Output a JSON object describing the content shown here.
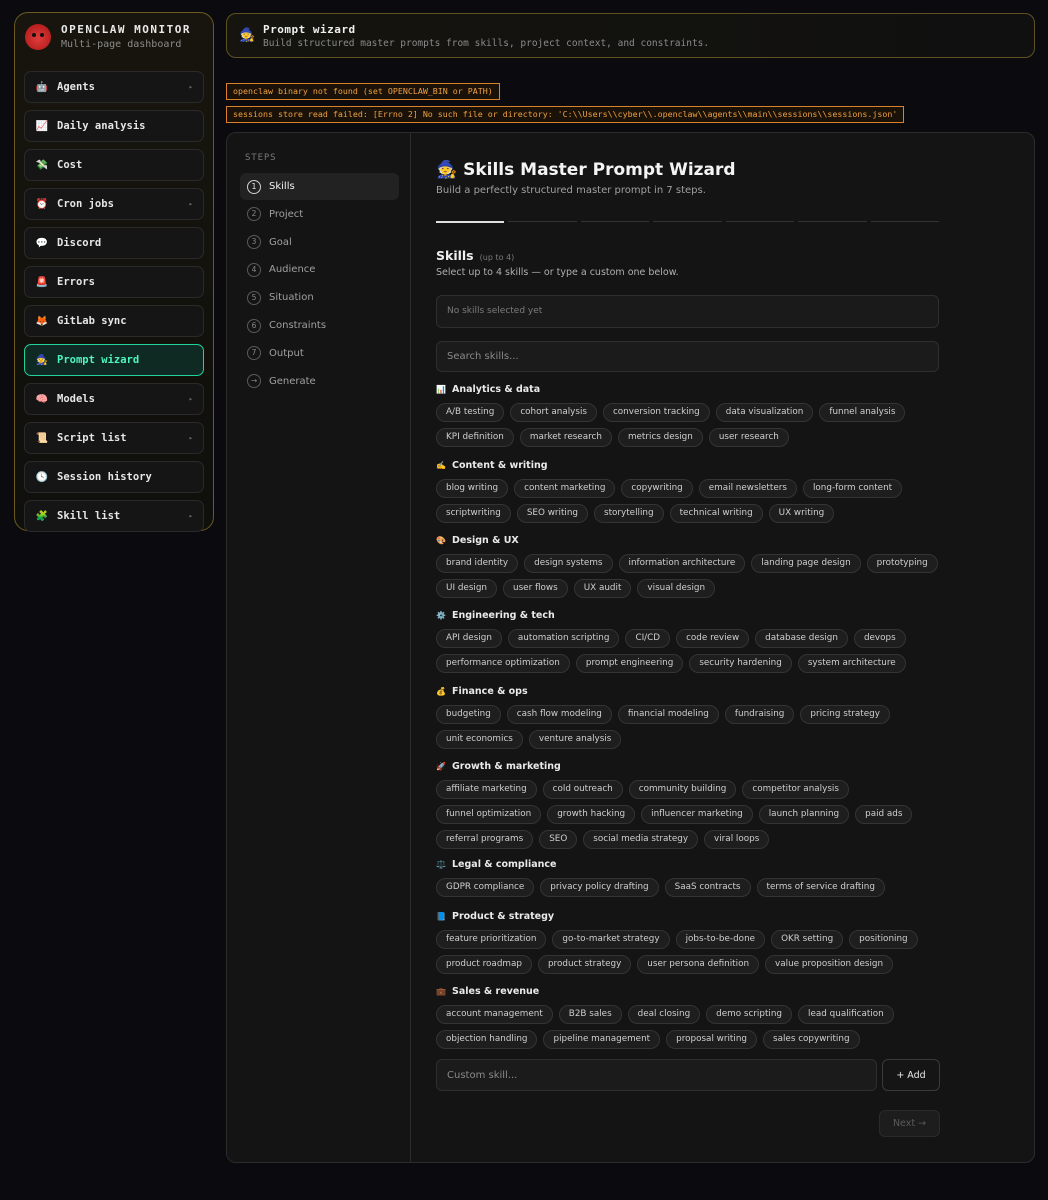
{
  "brand": {
    "title": "OPENCLAW MONITOR",
    "subtitle": "Multi-page dashboard"
  },
  "nav": [
    {
      "label": "Agents",
      "icon": "🤖",
      "chevron": true
    },
    {
      "label": "Daily analysis",
      "icon": "📈",
      "chevron": false
    },
    {
      "label": "Cost",
      "icon": "💸",
      "chevron": false
    },
    {
      "label": "Cron jobs",
      "icon": "⏰",
      "chevron": true
    },
    {
      "label": "Discord",
      "icon": "💬",
      "chevron": false
    },
    {
      "label": "Errors",
      "icon": "🚨",
      "chevron": false
    },
    {
      "label": "GitLab sync",
      "icon": "🦊",
      "chevron": false
    },
    {
      "label": "Prompt wizard",
      "icon": "🧙",
      "chevron": false,
      "active": true
    },
    {
      "label": "Models",
      "icon": "🧠",
      "chevron": true
    },
    {
      "label": "Script list",
      "icon": "📜",
      "chevron": true
    },
    {
      "label": "Session history",
      "icon": "🕓",
      "chevron": false
    },
    {
      "label": "Skill list",
      "icon": "🧩",
      "chevron": true
    }
  ],
  "header": {
    "icon": "🧙",
    "title": "Prompt wizard",
    "subtitle": "Build structured master prompts from skills, project context, and constraints."
  },
  "alerts": [
    "openclaw binary not found (set OPENCLAW_BIN or PATH)",
    "sessions store read failed: [Errno 2] No such file or directory: 'C:\\\\Users\\\\cyber\\\\.openclaw\\\\agents\\\\main\\\\sessions\\\\sessions.json'"
  ],
  "steps": {
    "label": "STEPS",
    "items": [
      {
        "num": "1",
        "label": "Skills",
        "active": true
      },
      {
        "num": "2",
        "label": "Project"
      },
      {
        "num": "3",
        "label": "Goal"
      },
      {
        "num": "4",
        "label": "Audience"
      },
      {
        "num": "5",
        "label": "Situation"
      },
      {
        "num": "6",
        "label": "Constraints"
      },
      {
        "num": "7",
        "label": "Output"
      },
      {
        "num": "→",
        "label": "Generate"
      }
    ]
  },
  "wizard": {
    "title": "🧙 Skills Master Prompt Wizard",
    "subtitle": "Build a perfectly structured master prompt in 7 steps.",
    "progress": {
      "current": 1,
      "total": 7
    },
    "section_title": "Skills",
    "section_hint": "(up to 4)",
    "section_desc": "Select up to 4 skills — or type a custom one below.",
    "selected_empty": "No skills selected yet",
    "search_placeholder": "Search skills...",
    "custom_placeholder": "Custom skill...",
    "add_label": "+ Add",
    "next_label": "Next →"
  },
  "categories": [
    {
      "name": "Analytics & data",
      "icon": "📊",
      "skills": [
        "A/B testing",
        "cohort analysis",
        "conversion tracking",
        "data visualization",
        "funnel analysis",
        "KPI definition",
        "market research",
        "metrics design",
        "user research"
      ]
    },
    {
      "name": "Content & writing",
      "icon": "✍️",
      "skills": [
        "blog writing",
        "content marketing",
        "copywriting",
        "email newsletters",
        "long-form content",
        "scriptwriting",
        "SEO writing",
        "storytelling",
        "technical writing",
        "UX writing"
      ]
    },
    {
      "name": "Design & UX",
      "icon": "🎨",
      "skills": [
        "brand identity",
        "design systems",
        "information architecture",
        "landing page design",
        "prototyping",
        "UI design",
        "user flows",
        "UX audit",
        "visual design"
      ]
    },
    {
      "name": "Engineering & tech",
      "icon": "⚙️",
      "skills": [
        "API design",
        "automation scripting",
        "CI/CD",
        "code review",
        "database design",
        "devops",
        "performance optimization",
        "prompt engineering",
        "security hardening",
        "system architecture"
      ]
    },
    {
      "name": "Finance & ops",
      "icon": "💰",
      "skills": [
        "budgeting",
        "cash flow modeling",
        "financial modeling",
        "fundraising",
        "pricing strategy",
        "unit economics",
        "venture analysis"
      ]
    },
    {
      "name": "Growth & marketing",
      "icon": "🚀",
      "skills": [
        "affiliate marketing",
        "cold outreach",
        "community building",
        "competitor analysis",
        "funnel optimization",
        "growth hacking",
        "influencer marketing",
        "launch planning",
        "paid ads",
        "referral programs",
        "SEO",
        "social media strategy",
        "viral loops"
      ]
    },
    {
      "name": "Legal & compliance",
      "icon": "⚖️",
      "skills": [
        "GDPR compliance",
        "privacy policy drafting",
        "SaaS contracts",
        "terms of service drafting"
      ]
    },
    {
      "name": "Product & strategy",
      "icon": "📘",
      "skills": [
        "feature prioritization",
        "go-to-market strategy",
        "jobs-to-be-done",
        "OKR setting",
        "positioning",
        "product roadmap",
        "product strategy",
        "user persona definition",
        "value proposition design"
      ]
    },
    {
      "name": "Sales & revenue",
      "icon": "💼",
      "skills": [
        "account management",
        "B2B sales",
        "deal closing",
        "demo scripting",
        "lead qualification",
        "objection handling",
        "pipeline management",
        "proposal writing",
        "sales copywriting"
      ]
    }
  ]
}
